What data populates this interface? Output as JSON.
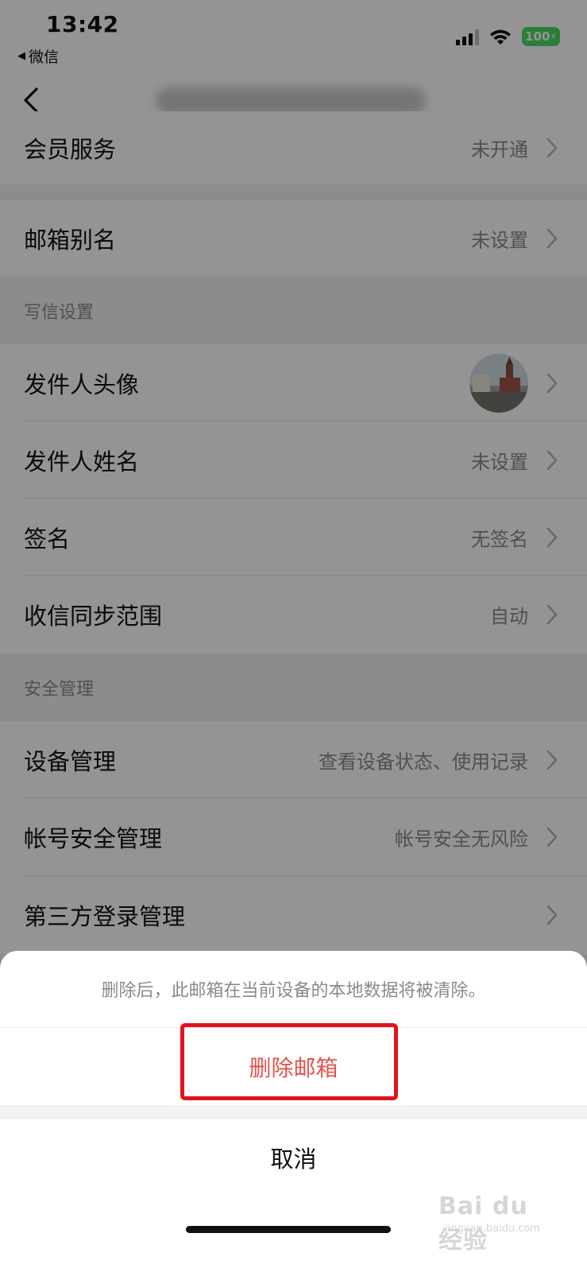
{
  "status_bar": {
    "time": "13:42",
    "back_app": "微信",
    "battery": "100"
  },
  "nav": {
    "back_icon": "chevron-left-icon"
  },
  "rows": {
    "membership": {
      "label": "会员服务",
      "value": "未开通"
    },
    "alias": {
      "label": "邮箱别名",
      "value": "未设置"
    },
    "sender_avatar": {
      "label": "发件人头像"
    },
    "sender_name": {
      "label": "发件人姓名",
      "value": "未设置"
    },
    "signature": {
      "label": "签名",
      "value": "无签名"
    },
    "sync_range": {
      "label": "收信同步范围",
      "value": "自动"
    },
    "device_mgmt": {
      "label": "设备管理",
      "value": "查看设备状态、使用记录"
    },
    "account_security": {
      "label": "帐号安全管理",
      "value": "帐号安全无风险"
    },
    "third_party": {
      "label": "第三方登录管理"
    }
  },
  "sections": {
    "compose": "写信设置",
    "security": "安全管理"
  },
  "action_sheet": {
    "message": "删除后，此邮箱在当前设备的本地数据将被清除。",
    "delete_label": "删除邮箱",
    "cancel_label": "取消"
  },
  "colors": {
    "destructive": "#e2534f",
    "highlight_box": "#e1141b",
    "battery": "#4cd964"
  },
  "watermark": {
    "main": "Bai du 经验",
    "sub": "jingyan.baidu.com"
  }
}
